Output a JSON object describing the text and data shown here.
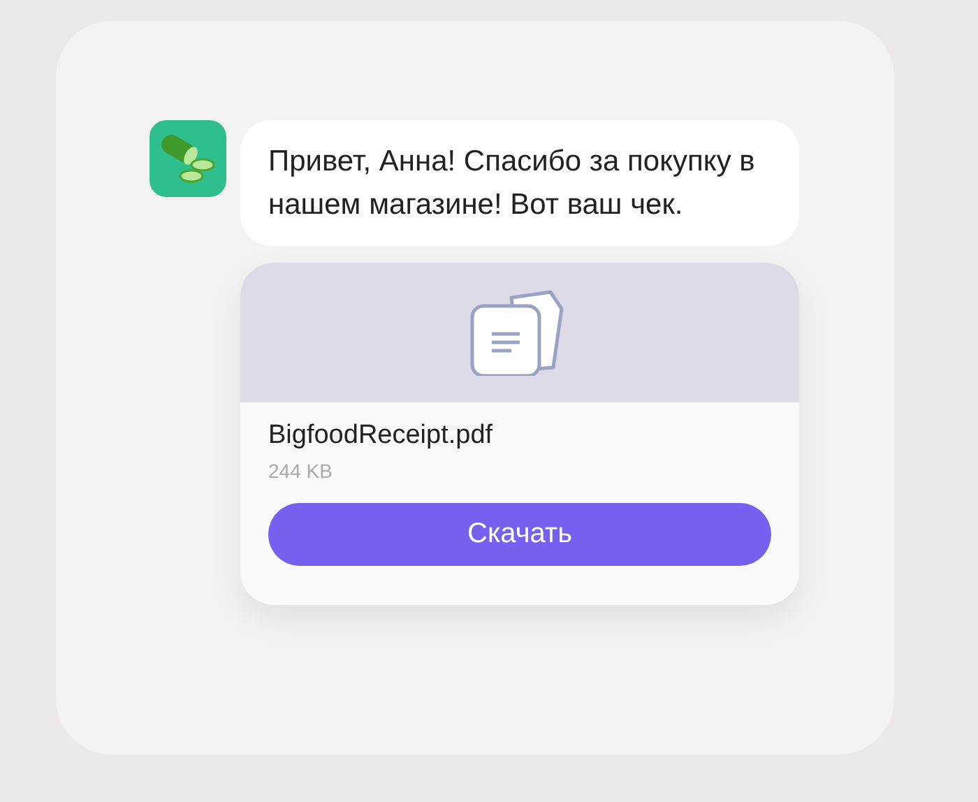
{
  "message": {
    "text": "Привет, Анна! Спасибо за покупку в нашем магазине! Вот ваш чек."
  },
  "attachment": {
    "file_name": "BigfoodReceipt.pdf",
    "file_size": "244 KB",
    "button": "Скачать"
  }
}
